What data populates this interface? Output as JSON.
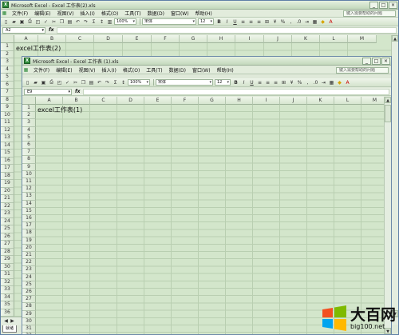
{
  "back_window": {
    "title": "Microsoft Excel - Excel 工作表(2).xls",
    "menu": [
      "文件(F)",
      "编辑(E)",
      "视图(V)",
      "插入(I)",
      "格式(O)",
      "工具(T)",
      "数据(D)",
      "窗口(W)",
      "帮助(H)"
    ],
    "help_placeholder": "键入需要帮助的问题",
    "zoom": "100%",
    "font": "宋体",
    "font_size": "12",
    "name_box": "A2",
    "fx": "fx",
    "columns": [
      "A",
      "B",
      "C",
      "D",
      "E",
      "F",
      "G",
      "H",
      "I",
      "J",
      "K",
      "L",
      "M"
    ],
    "rows": [
      "1",
      "2",
      "3",
      "4",
      "5",
      "6",
      "7",
      "8",
      "9",
      "10",
      "11",
      "12",
      "13",
      "14",
      "15",
      "16",
      "17",
      "18",
      "19",
      "20",
      "21",
      "22",
      "23",
      "24",
      "25",
      "26",
      "27",
      "28",
      "29",
      "30",
      "31",
      "32",
      "33",
      "34",
      "35",
      "36"
    ],
    "cell_a1": "excel工作表(2)",
    "sheet_tab": "就绪"
  },
  "front_window": {
    "title": "Microsoft Excel - Excel 工作表 (1).xls",
    "menu": [
      "文件(F)",
      "编辑(E)",
      "视图(V)",
      "插入(I)",
      "格式(O)",
      "工具(T)",
      "数据(D)",
      "窗口(W)",
      "帮助(H)"
    ],
    "help_placeholder": "键入需要帮助的问题",
    "zoom": "100%",
    "font": "宋体",
    "font_size": "12",
    "name_box": "E9",
    "fx": "fx",
    "columns": [
      "A",
      "B",
      "C",
      "D",
      "E",
      "F",
      "G",
      "H",
      "I",
      "J",
      "K",
      "L",
      "M"
    ],
    "rows": [
      "1",
      "2",
      "3",
      "4",
      "5",
      "6",
      "7",
      "8",
      "9",
      "10",
      "11",
      "12",
      "13",
      "14",
      "15",
      "16",
      "17",
      "18",
      "19",
      "20",
      "21",
      "22",
      "23",
      "24",
      "25",
      "26",
      "27",
      "28",
      "29",
      "30",
      "31",
      "32"
    ],
    "cell_a1": "excel工作表(1)"
  },
  "watermark": {
    "brand": "大百网",
    "url": "big100.net"
  }
}
